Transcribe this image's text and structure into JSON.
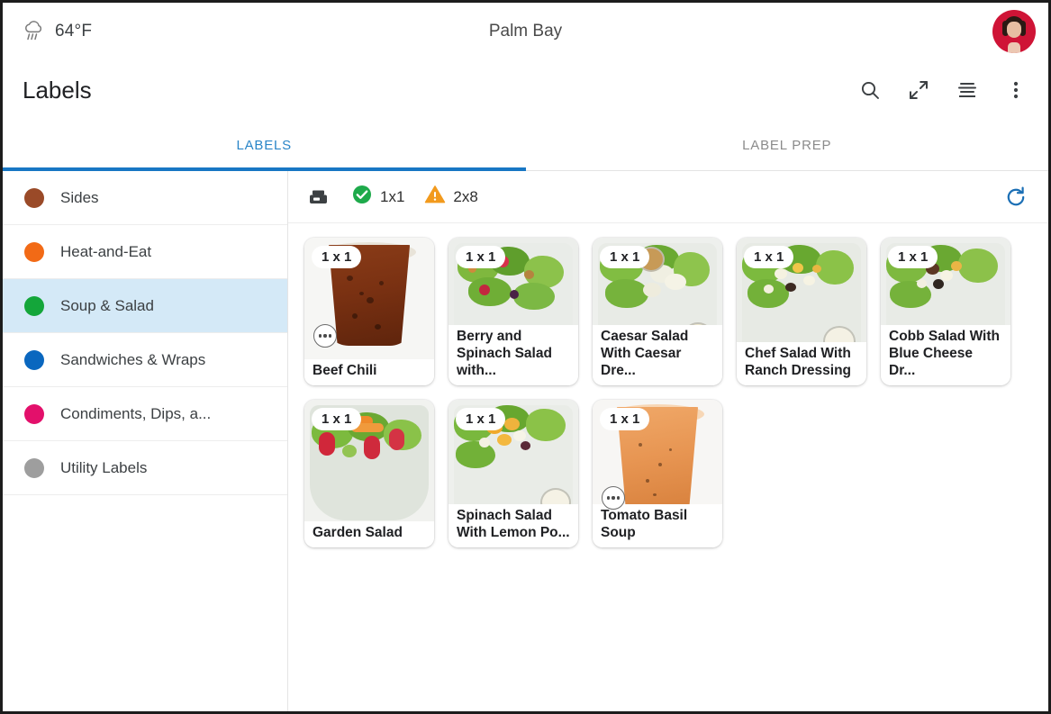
{
  "topbar": {
    "weather_icon": "rain-cloud-icon",
    "temperature": "64°F",
    "location": "Palm Bay",
    "avatar_label": "user-avatar"
  },
  "header": {
    "title": "Labels",
    "actions": [
      {
        "name": "search-icon",
        "label": "Search"
      },
      {
        "name": "expand-icon",
        "label": "Expand"
      },
      {
        "name": "print-queue-icon",
        "label": "Print queue"
      },
      {
        "name": "more-vertical-icon",
        "label": "More options"
      }
    ]
  },
  "tabs": [
    {
      "label": "LABELS",
      "active": true
    },
    {
      "label": "LABEL PREP",
      "active": false
    }
  ],
  "sidebar": {
    "items": [
      {
        "label": "Sides",
        "color": "#9a4a28",
        "selected": false
      },
      {
        "label": "Heat-and-Eat",
        "color": "#f26a16",
        "selected": false
      },
      {
        "label": "Soup & Salad",
        "color": "#14a63a",
        "selected": true
      },
      {
        "label": "Sandwiches & Wraps",
        "color": "#0a67bf",
        "selected": false
      },
      {
        "label": "Condiments, Dips, a...",
        "color": "#e3106b",
        "selected": false
      },
      {
        "label": "Utility Labels",
        "color": "#9e9e9e",
        "selected": false
      }
    ]
  },
  "toolbar": {
    "printer_icon": "printer-icon",
    "status": [
      {
        "icon": "check-circle-icon",
        "label": "1x1",
        "color": "#1eaa4b"
      },
      {
        "icon": "warning-triangle-icon",
        "label": "2x8",
        "color": "#f29a1d"
      }
    ],
    "refresh_icon": "refresh-icon",
    "refresh_color": "#1b6fb5"
  },
  "cards": [
    {
      "qty": "1 x 1",
      "title": "Beef Chili",
      "photo": "chili-cup",
      "has_more": true
    },
    {
      "qty": "1 x 1",
      "title": "Berry and Spinach Salad with...",
      "photo": "berry-spinach-salad",
      "has_more": false
    },
    {
      "qty": "1 x 1",
      "title": "Caesar Salad With Caesar Dre...",
      "photo": "caesar-salad",
      "has_more": false
    },
    {
      "qty": "1 x 1",
      "title": "Chef Salad With Ranch Dressing",
      "photo": "chef-salad",
      "has_more": false
    },
    {
      "qty": "1 x 1",
      "title": "Cobb Salad With Blue Cheese Dr...",
      "photo": "cobb-salad",
      "has_more": false
    },
    {
      "qty": "1 x 1",
      "title": "Garden Salad",
      "photo": "garden-salad",
      "has_more": false
    },
    {
      "qty": "1 x 1",
      "title": "Spinach Salad With Lemon Po...",
      "photo": "spinach-salad",
      "has_more": false
    },
    {
      "qty": "1 x 1",
      "title": "Tomato Basil Soup",
      "photo": "tomato-soup",
      "has_more": true
    }
  ],
  "colors": {
    "accent": "#1877c4",
    "tab_active_text": "#2a86c8",
    "selected_row_bg": "#d4e9f7",
    "text_primary": "#202124",
    "text_muted": "#8b8b8b"
  }
}
